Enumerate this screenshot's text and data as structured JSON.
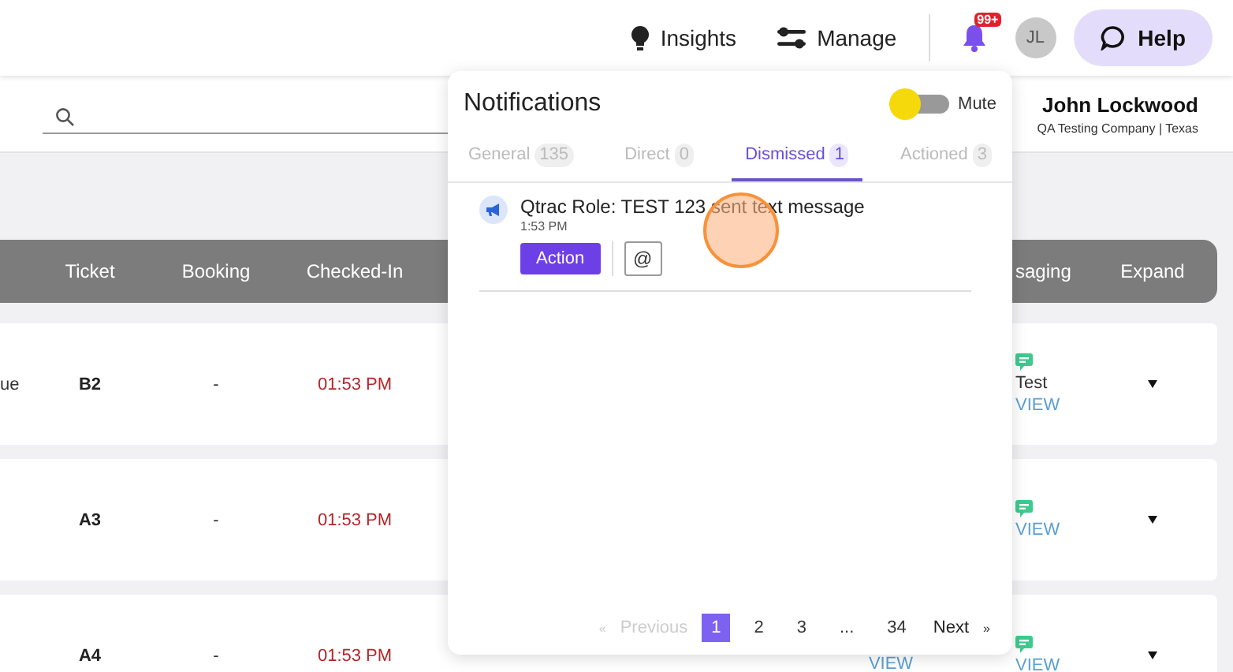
{
  "topbar": {
    "insights": "Insights",
    "manage": "Manage",
    "notification_badge": "99+",
    "avatar": "JL",
    "help": "Help"
  },
  "user": {
    "name": "John Lockwood",
    "company": "QA Testing Company | Texas"
  },
  "table": {
    "columns": [
      "Ticket",
      "Booking",
      "Checked-In",
      "saging",
      "Expand"
    ],
    "rows": [
      {
        "column_1": "ue",
        "ticket": "B2",
        "booking": "-",
        "checked_in": "01:53 PM",
        "messaging": {
          "name": "Test",
          "link": "VIEW"
        }
      },
      {
        "ticket": "A3",
        "booking": "-",
        "checked_in": "01:53 PM",
        "messaging": {
          "link": "VIEW"
        }
      },
      {
        "ticket": "A4",
        "booking": "-",
        "checked_in": "01:53 PM",
        "column_6": "VIEW",
        "messaging": {
          "link": "VIEW"
        }
      }
    ]
  },
  "notifications": {
    "title": "Notifications",
    "mute": {
      "label": "Mute",
      "on": false
    },
    "tabs": [
      {
        "label": "General",
        "count": "135",
        "selected": false
      },
      {
        "label": "Direct",
        "count": "0",
        "selected": false
      },
      {
        "label": "Dismissed",
        "count": "1",
        "selected": true
      },
      {
        "label": "Actioned",
        "count": "3",
        "selected": false
      }
    ],
    "items": [
      {
        "title": "Qtrac Role: TEST 123 sent text message",
        "time": "1:53 PM",
        "action": "Action",
        "mention": "@"
      }
    ],
    "pagination": {
      "first_mark": "«",
      "previous": "Previous",
      "previous_disabled": true,
      "pages": [
        {
          "label": "1",
          "selected": true
        },
        {
          "label": "2",
          "selected": false
        },
        {
          "label": "3",
          "selected": false
        },
        {
          "label": "...",
          "selected": false
        },
        {
          "label": "34",
          "selected": false
        }
      ],
      "next": "Next",
      "last_mark": "»"
    }
  }
}
